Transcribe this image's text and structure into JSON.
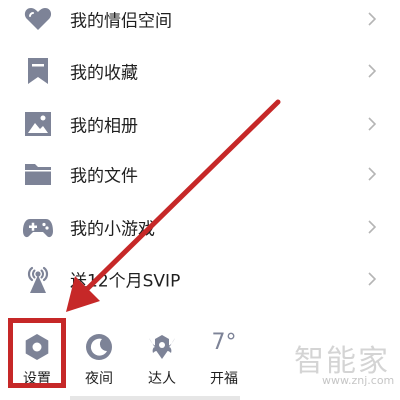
{
  "menu": {
    "items": [
      {
        "label": "我的情侣空间",
        "icon": "heart-icon"
      },
      {
        "label": "我的收藏",
        "icon": "bookmark-icon"
      },
      {
        "label": "我的相册",
        "icon": "photo-album-icon"
      },
      {
        "label": "我的文件",
        "icon": "folder-icon"
      },
      {
        "label": "我的小游戏",
        "icon": "gamepad-icon"
      },
      {
        "label": "送12个月SVIP",
        "icon": "broadcast-tower-icon"
      }
    ]
  },
  "bottom_bar": {
    "settings": {
      "label": "设置",
      "icon": "hexagon-settings-icon"
    },
    "night": {
      "label": "夜间",
      "icon": "moon-icon"
    },
    "expert": {
      "label": "达人",
      "icon": "winged-badge-icon"
    },
    "weather": {
      "label": "开福",
      "temp": "7°"
    }
  },
  "watermark": {
    "text": "智能家",
    "url": "www.znj.com"
  },
  "colors": {
    "icon": "#7d8397",
    "highlight": "#c62828",
    "chevron": "#b5b5b5"
  }
}
